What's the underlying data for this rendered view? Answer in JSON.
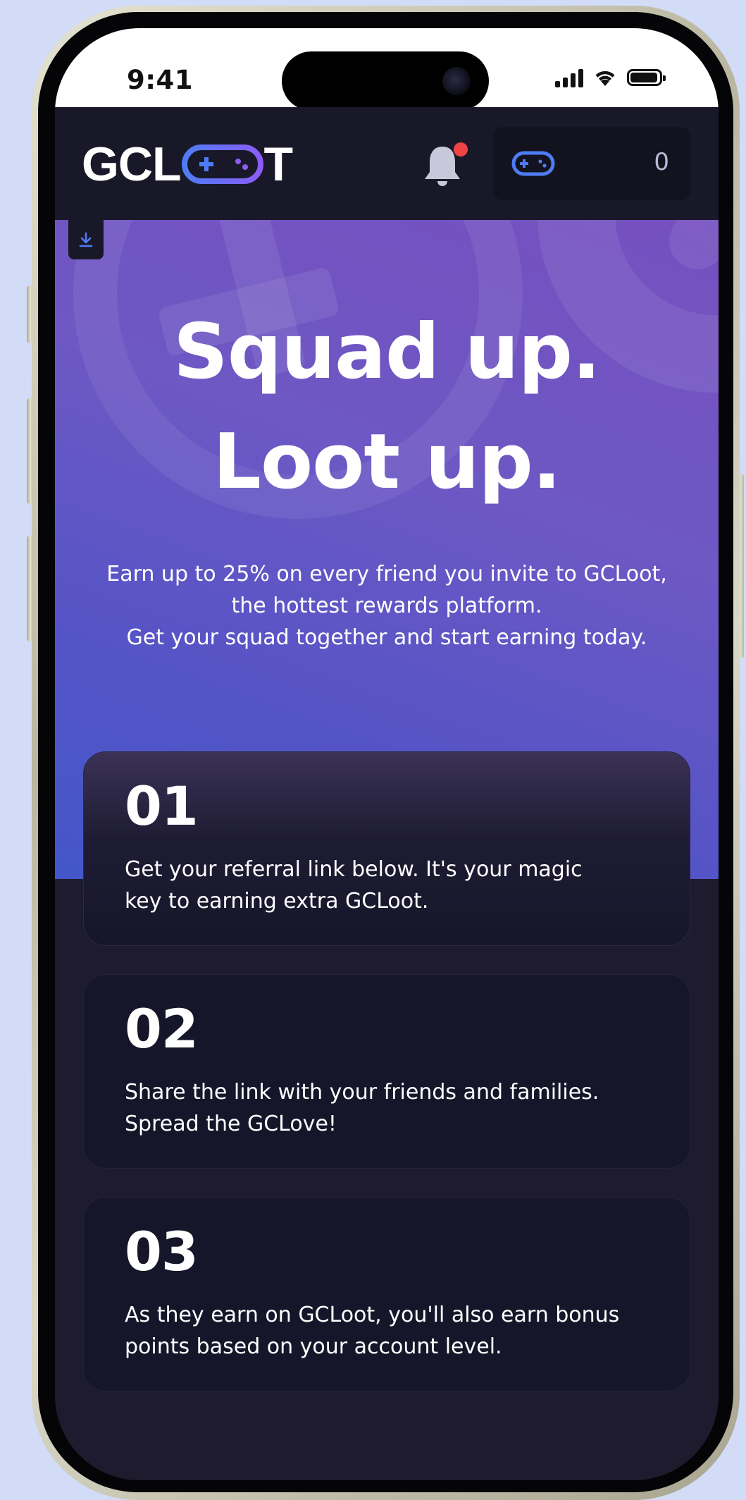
{
  "status_bar": {
    "time": "9:41"
  },
  "header": {
    "logo_text_left": "GCL",
    "logo_text_right": "T",
    "wallet_value": "0"
  },
  "hero": {
    "title_line1": "Squad up.",
    "title_line2": "Loot up.",
    "subtitle_line1": "Earn up to 25% on every friend you invite to GCLoot,",
    "subtitle_line2": "the hottest rewards platform.",
    "subtitle_line3": "Get your squad together and start earning today."
  },
  "steps": [
    {
      "number": "01",
      "line1": "Get your referral link below. It's your magic",
      "line2": "key to earning extra GCLoot."
    },
    {
      "number": "02",
      "line1": "Share the link with your friends and families.",
      "line2": "Spread the GCLove!"
    },
    {
      "number": "03",
      "line1": "As they earn on GCLoot, you'll also earn bonus",
      "line2": "points based on your account level."
    }
  ],
  "colors": {
    "accent": "#4f7cf5",
    "header_bg": "#191828",
    "page_bg": "#1d1b2d",
    "notification_dot": "#ef4444"
  },
  "icons": {
    "notification": "bell-icon",
    "wallet": "gamepad-icon",
    "download": "download-icon"
  }
}
